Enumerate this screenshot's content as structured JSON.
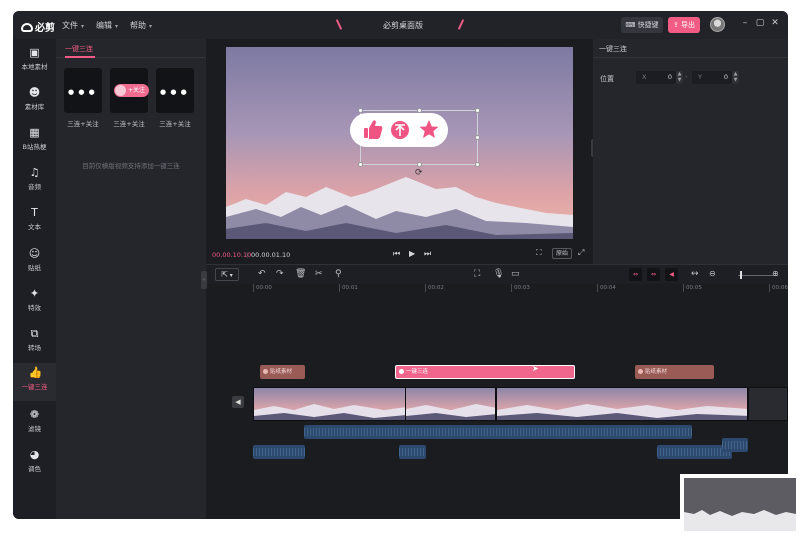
{
  "app": {
    "logo_text": "必剪",
    "title": "必剪桌面版"
  },
  "menu": {
    "file": "文件",
    "edit": "编辑",
    "help": "帮助"
  },
  "titlebar": {
    "shortcut_label": "快捷键",
    "export_label": "导出"
  },
  "sidebar": {
    "items": [
      {
        "label": "本地素材",
        "icon": "folder-upload-icon"
      },
      {
        "label": "素材库",
        "icon": "skull-icon"
      },
      {
        "label": "B站热梗",
        "icon": "tv-icon"
      },
      {
        "label": "音频",
        "icon": "music-note-icon"
      },
      {
        "label": "文本",
        "icon": "text-icon"
      },
      {
        "label": "贴纸",
        "icon": "sticker-icon"
      },
      {
        "label": "特效",
        "icon": "sparkle-icon"
      },
      {
        "label": "转场",
        "icon": "transition-icon"
      },
      {
        "label": "一键三连",
        "icon": "thumbs-up-icon",
        "active": true
      },
      {
        "label": "滤镜",
        "icon": "filter-icon"
      },
      {
        "label": "调色",
        "icon": "palette-icon"
      }
    ]
  },
  "library": {
    "tab_label": "一键三连",
    "tiles": [
      {
        "label": "三连+关注"
      },
      {
        "label": "三连+关注",
        "pill_text": "+关注"
      },
      {
        "label": "三连+关注"
      }
    ],
    "note": "目前仅横版视频支持添加一键三连"
  },
  "preview": {
    "current_time": "00.00.10.10",
    "total_time": "00.00.01.10",
    "original_label": "原始"
  },
  "props": {
    "tab_label": "一键三连",
    "position_label": "位置",
    "x_label": "X",
    "x_value": "0",
    "y_label": "Y",
    "y_value": "0"
  },
  "timeline": {
    "ruler_labels": [
      "00:00",
      "00:01",
      "00:02",
      "00:03",
      "00:04",
      "00:05",
      "00:06"
    ],
    "sticker_clip_1": "贴纸素材",
    "sanlian_clip": "一键三连",
    "sticker_clip_2": "贴纸素材"
  },
  "colors": {
    "accent": "#f25b84",
    "background": "#1b1c20",
    "panel": "#25262c"
  }
}
